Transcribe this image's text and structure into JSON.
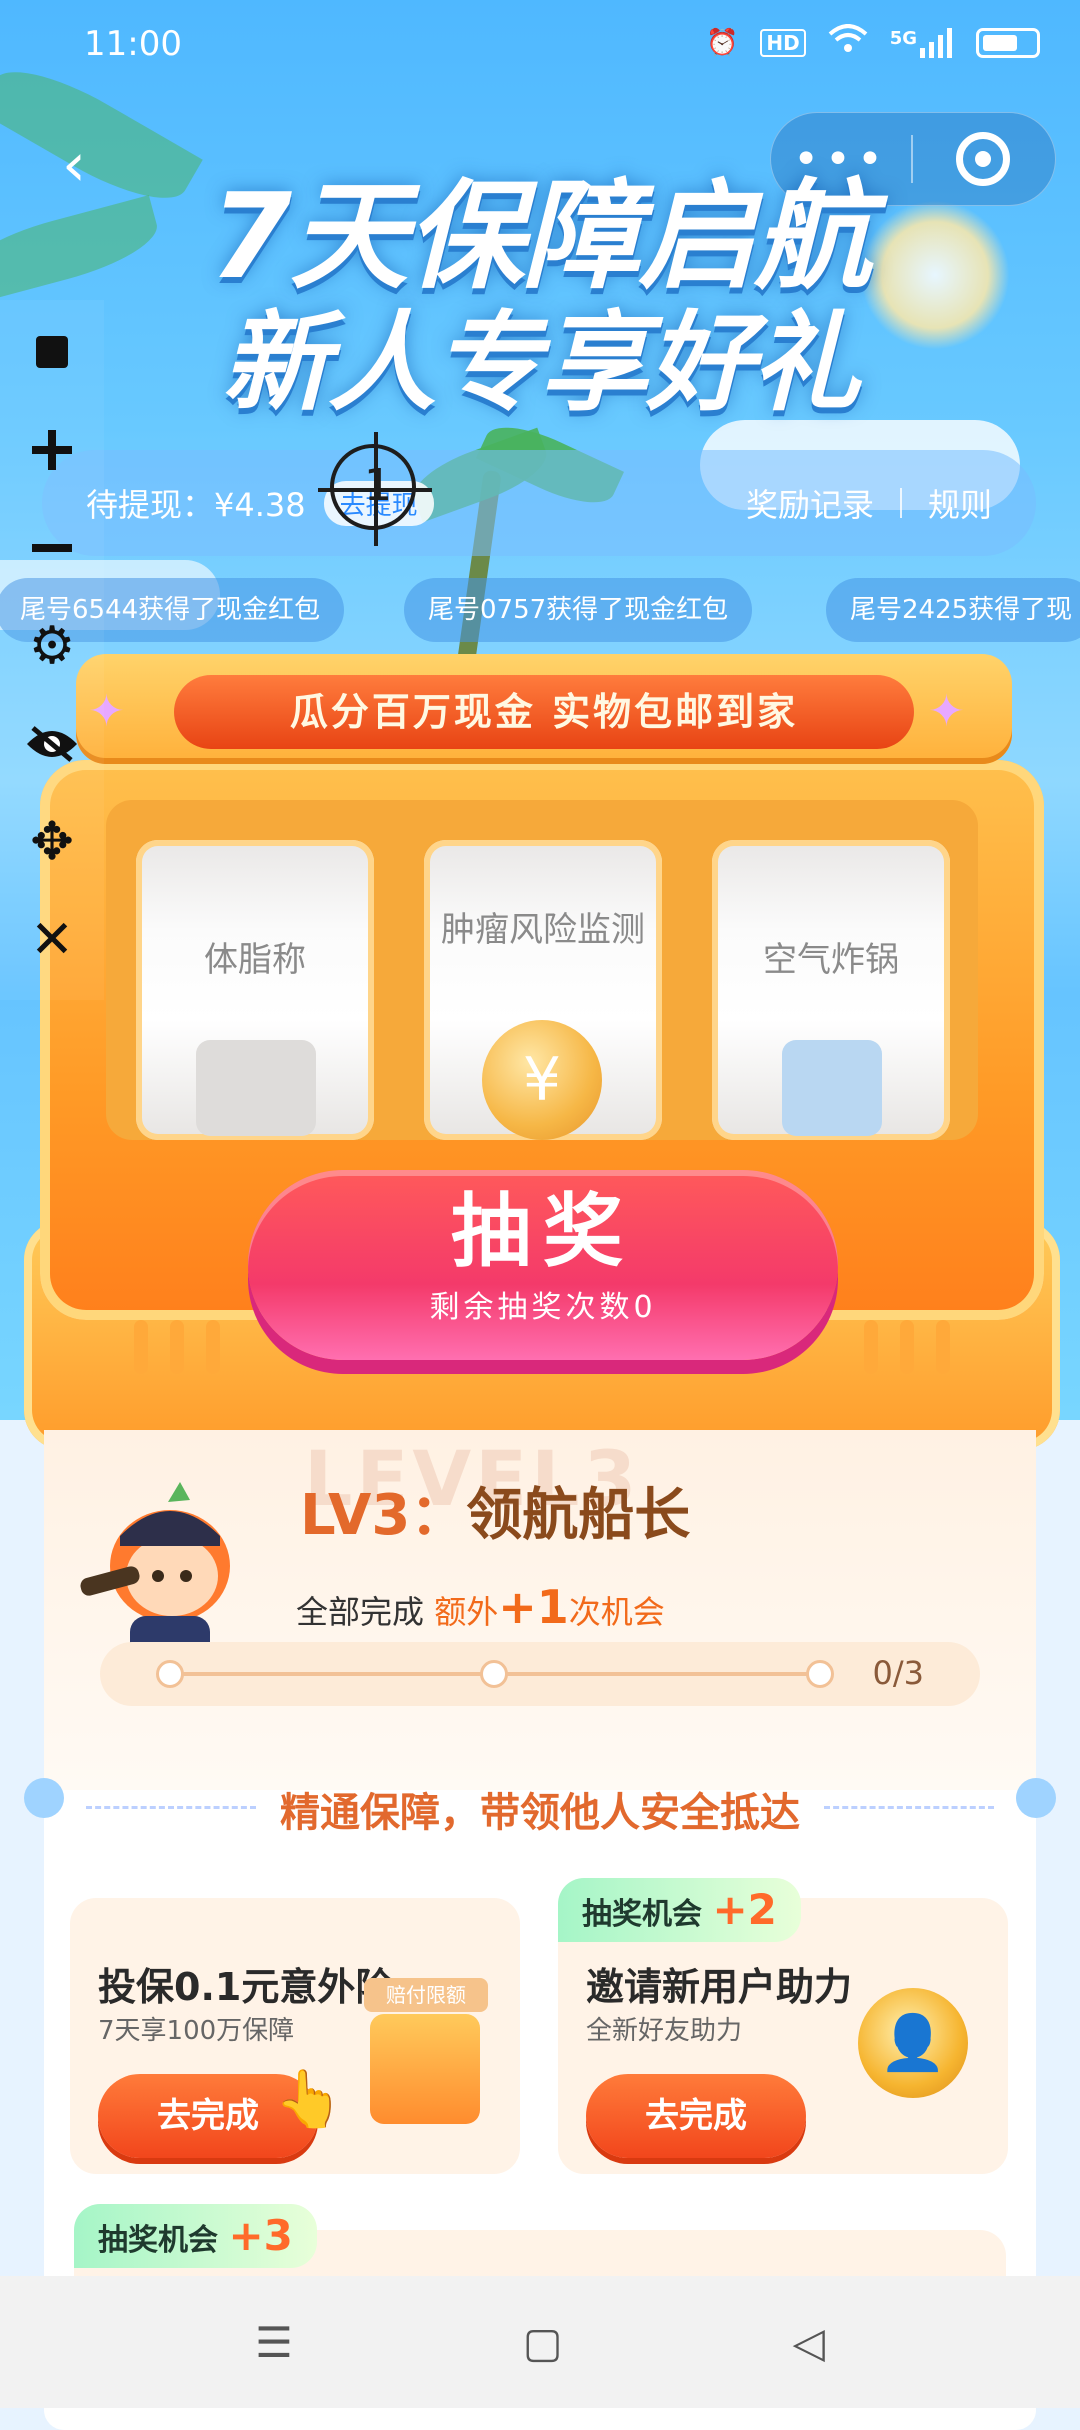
{
  "status_bar": {
    "time": "11:00",
    "icons": [
      "alarm-icon",
      "hd-icon",
      "wifi-icon",
      "5g-signal-icon",
      "battery-icon"
    ],
    "hd_label": "HD",
    "net_label": "5G"
  },
  "header": {
    "title_line1": "7天保障启航",
    "title_line2": "新人专享好礼",
    "more_label": "•••"
  },
  "info_bar": {
    "pending_label": "待提现：¥4.38",
    "withdraw_label": "去提现",
    "records_label": "奖励记录",
    "rules_label": "规则"
  },
  "ticker": [
    "尾号6544获得了现金红包",
    "尾号0757获得了现金红包",
    "尾号2425获得了现"
  ],
  "machine": {
    "banner": "瓜分百万现金 实物包邮到家",
    "reels": [
      "体脂称",
      "肿瘤风险监测",
      "空气炸锅"
    ],
    "coin_symbol": "¥",
    "draw_label": "抽奖",
    "remaining_label": "剩余抽奖次数0"
  },
  "level": {
    "ghost_text": "LEVEL3",
    "tag": "LV3：",
    "name": "领航船长",
    "sub_prefix": "全部完成 ",
    "sub_extra": "额外",
    "sub_plus": "+1",
    "sub_suffix": "次机会",
    "progress_done": 0,
    "progress_total": 3,
    "progress_text": "0/3"
  },
  "section_title": "精通保障，带领他人安全抵达",
  "tasks": [
    {
      "title": "投保0.1元意外险",
      "desc": "7天享100万保障",
      "button": "去完成",
      "gift_label": "赔付限额"
    },
    {
      "title": "邀请新用户助力",
      "desc": "全新好友助力",
      "button": "去完成",
      "badge": "抽奖机会",
      "badge_n": "+2",
      "medal_symbol": "👤"
    }
  ],
  "task3": {
    "badge": "抽奖机会",
    "badge_n": "+3"
  },
  "overlay": {
    "marker_number": "1"
  },
  "colors": {
    "accent": "#f2461c",
    "draw_button": "#f43a6a",
    "sky": "#4fb8ff",
    "section_title": "#e2692e"
  }
}
